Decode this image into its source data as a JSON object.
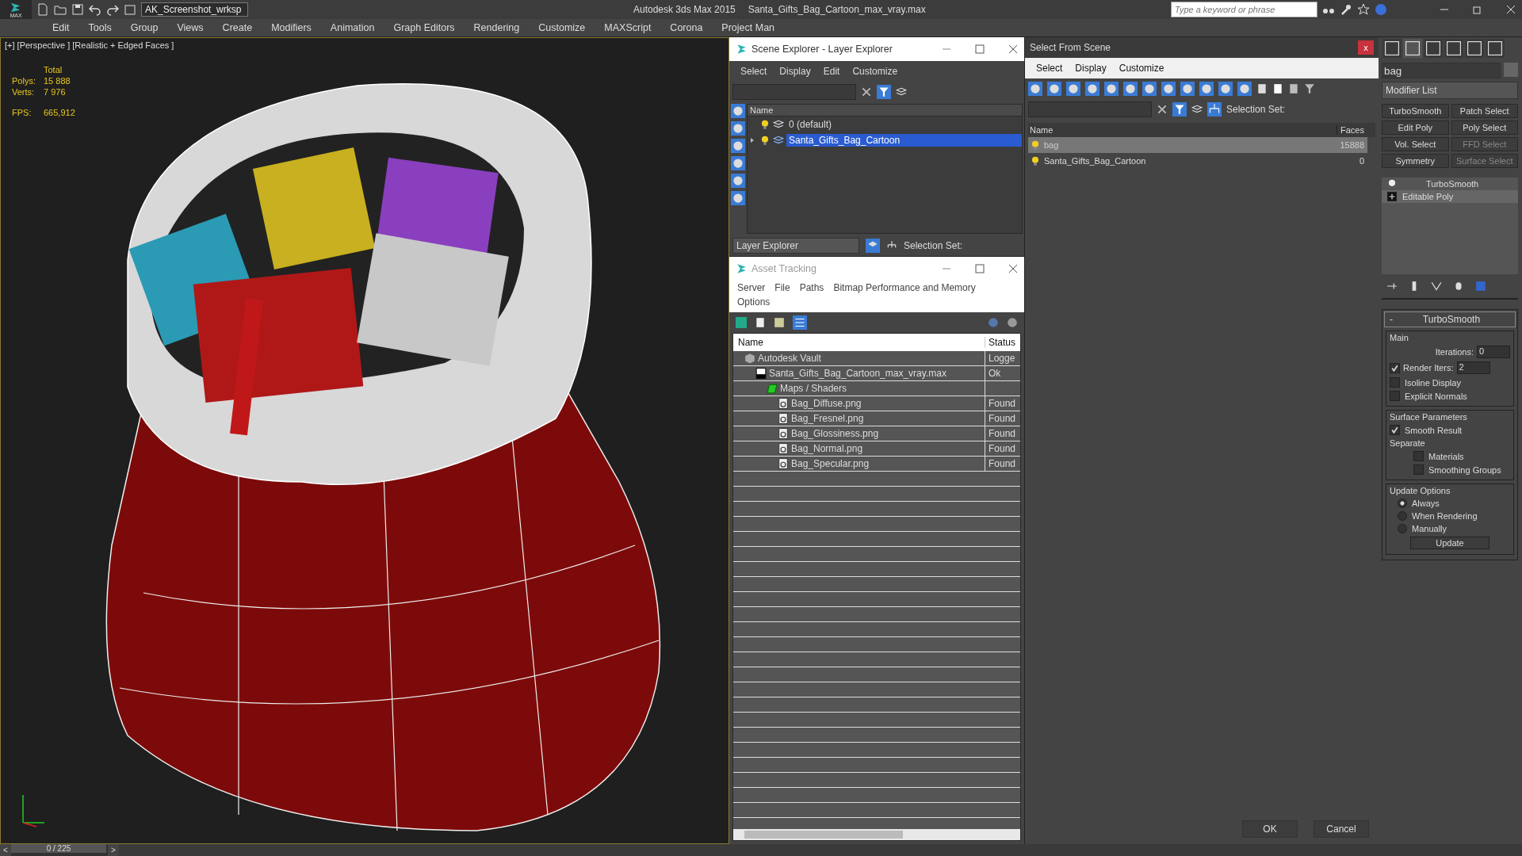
{
  "app": {
    "logo": "MAX",
    "workspace": "AK_Screenshot_wrksp",
    "title": "Autodesk 3ds Max  2015",
    "file": "Santa_Gifts_Bag_Cartoon_max_vray.max",
    "search_placeholder": "Type a keyword or phrase"
  },
  "menu": [
    "Edit",
    "Tools",
    "Group",
    "Views",
    "Create",
    "Modifiers",
    "Animation",
    "Graph Editors",
    "Rendering",
    "Customize",
    "MAXScript",
    "Corona",
    "Project Man"
  ],
  "viewport": {
    "label": "[+] [Perspective ] [Realistic + Edged Faces ]",
    "heading": "Total",
    "stats": [
      {
        "label": "Polys:",
        "value": "15 888"
      },
      {
        "label": "Verts:",
        "value": "7 976"
      }
    ],
    "fps_label": "FPS:",
    "fps": "665,912"
  },
  "timeline": {
    "prev": "<",
    "frame": "0 / 225",
    "next": ">",
    "level": 0
  },
  "scene_explorer": {
    "title": "Scene Explorer - Layer Explorer",
    "menu": [
      "Select",
      "Display",
      "Edit",
      "Customize"
    ],
    "column": "Name",
    "layers": [
      {
        "name": "0 (default)",
        "selected": false,
        "expandable": false
      },
      {
        "name": "Santa_Gifts_Bag_Cartoon",
        "selected": true,
        "expandable": true
      }
    ],
    "explorer": "Layer Explorer",
    "selection_set": "Selection Set:"
  },
  "asset_tracking": {
    "title": "Asset Tracking",
    "menu": [
      "Server",
      "File",
      "Paths",
      "Bitmap Performance and Memory",
      "Options"
    ],
    "columns": [
      "Name",
      "Status"
    ],
    "rows": [
      {
        "kind": "vault",
        "name": "Autodesk Vault",
        "status": "Logge",
        "children": [
          {
            "kind": "max",
            "name": "Santa_Gifts_Bag_Cartoon_max_vray.max",
            "status": "Ok",
            "children": [
              {
                "kind": "folder",
                "name": "Maps / Shaders",
                "children": [
                  {
                    "kind": "image",
                    "name": "Bag_Diffuse.png",
                    "status": "Found"
                  },
                  {
                    "kind": "image",
                    "name": "Bag_Fresnel.png",
                    "status": "Found"
                  },
                  {
                    "kind": "image",
                    "name": "Bag_Glossiness.png",
                    "status": "Found"
                  },
                  {
                    "kind": "image",
                    "name": "Bag_Normal.png",
                    "status": "Found"
                  },
                  {
                    "kind": "image",
                    "name": "Bag_Specular.png",
                    "status": "Found"
                  }
                ]
              }
            ]
          }
        ]
      }
    ]
  },
  "select_from_scene": {
    "title": "Select From Scene",
    "close": "x",
    "menu": [
      "Select",
      "Display",
      "Customize"
    ],
    "selection_set": "Selection Set:",
    "columns": [
      "Name",
      "Faces"
    ],
    "rows": [
      {
        "name": "bag",
        "faces": "15888",
        "selected": true
      },
      {
        "name": "Santa_Gifts_Bag_Cartoon",
        "faces": "0",
        "selected": false
      }
    ],
    "buttons": [
      "OK",
      "Cancel"
    ]
  },
  "command_panel": {
    "object_name": "bag",
    "modifier_list": "Modifier List",
    "modifier_buttons": [
      {
        "label": "TurboSmooth",
        "disabled": false
      },
      {
        "label": "Patch Select",
        "disabled": false
      },
      {
        "label": "Edit Poly",
        "disabled": false
      },
      {
        "label": "Poly Select",
        "disabled": false
      },
      {
        "label": "Vol. Select",
        "disabled": false
      },
      {
        "label": "FFD Select",
        "disabled": true
      },
      {
        "label": "Symmetry",
        "disabled": false
      },
      {
        "label": "Surface Select",
        "disabled": true
      }
    ],
    "stack": [
      {
        "kind": "modifier",
        "name": "TurboSmooth",
        "selected": false
      },
      {
        "kind": "base",
        "name": "Editable Poly",
        "selected": true
      }
    ],
    "rollout": {
      "collapse": "-",
      "title": "TurboSmooth",
      "main": "Main",
      "iterations_label": "Iterations:",
      "iterations": "0",
      "render_iters_label": "Render Iters:",
      "render_iters_checked": true,
      "render_iters": "2",
      "options": [
        {
          "label": "Isoline Display",
          "checked": false
        },
        {
          "label": "Explicit Normals",
          "checked": false
        }
      ],
      "surface": "Surface Parameters",
      "smooth_result": {
        "label": "Smooth Result",
        "checked": true
      },
      "separate": "Separate",
      "separate_options": [
        {
          "label": "Materials",
          "checked": false
        },
        {
          "label": "Smoothing Groups",
          "checked": false
        }
      ],
      "update_options": "Update Options",
      "radios": [
        {
          "label": "Always",
          "selected": true
        },
        {
          "label": "When Rendering",
          "selected": false
        },
        {
          "label": "Manually",
          "selected": false
        }
      ],
      "update": "Update"
    }
  }
}
